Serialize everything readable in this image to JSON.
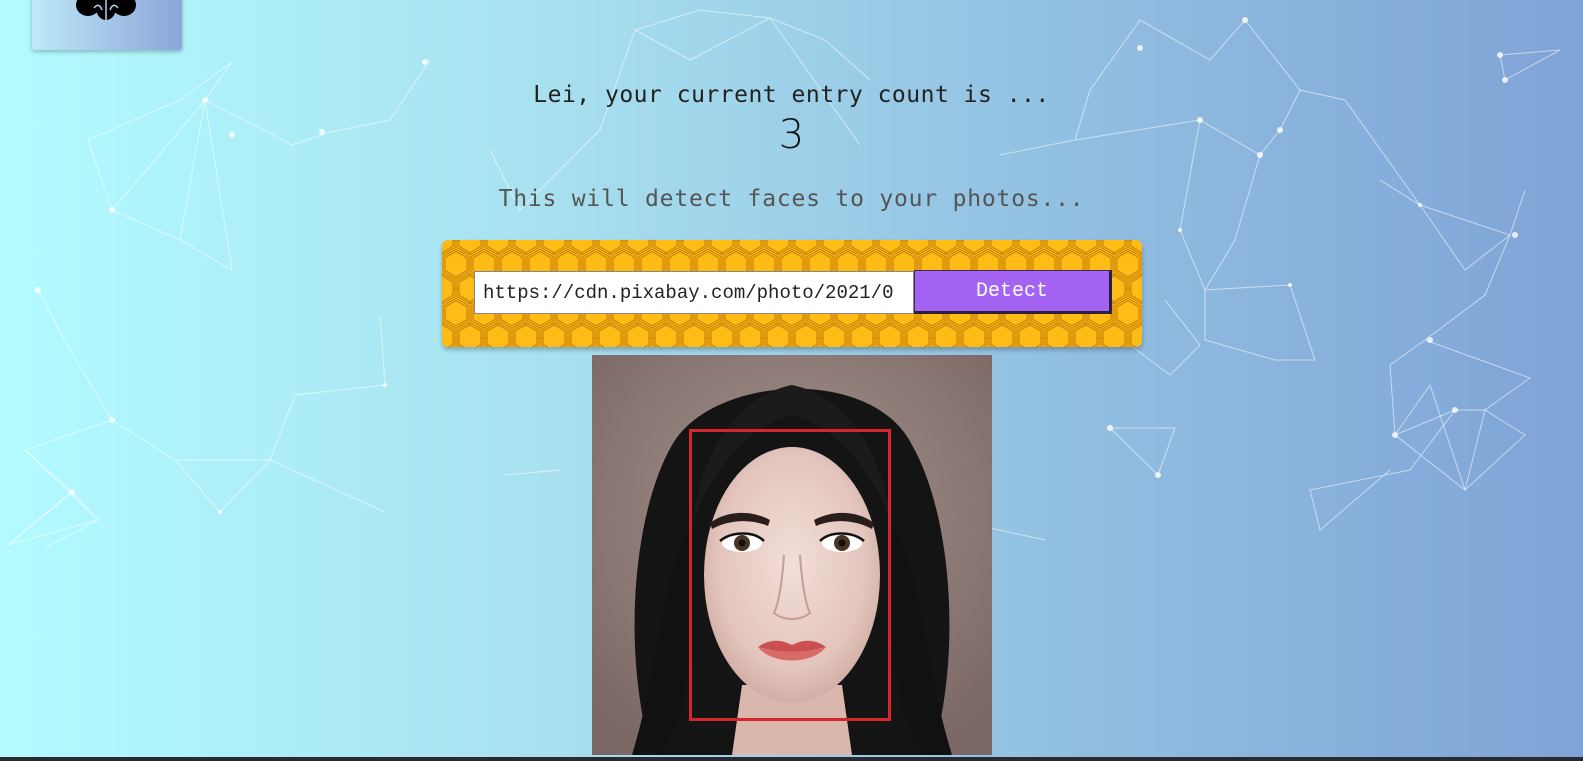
{
  "header": {
    "entry_message": "Lei, your current entry count is ...",
    "entry_count": "3"
  },
  "form": {
    "description": "This will detect faces to your photos...",
    "url_value": "https://cdn.pixabay.com/photo/2021/0",
    "detect_label": "Detect"
  },
  "colors": {
    "panel": "#ffbb16",
    "button": "#a463f2",
    "face_box": "#d5242a"
  },
  "icons": {
    "logo": "brain-icon"
  }
}
